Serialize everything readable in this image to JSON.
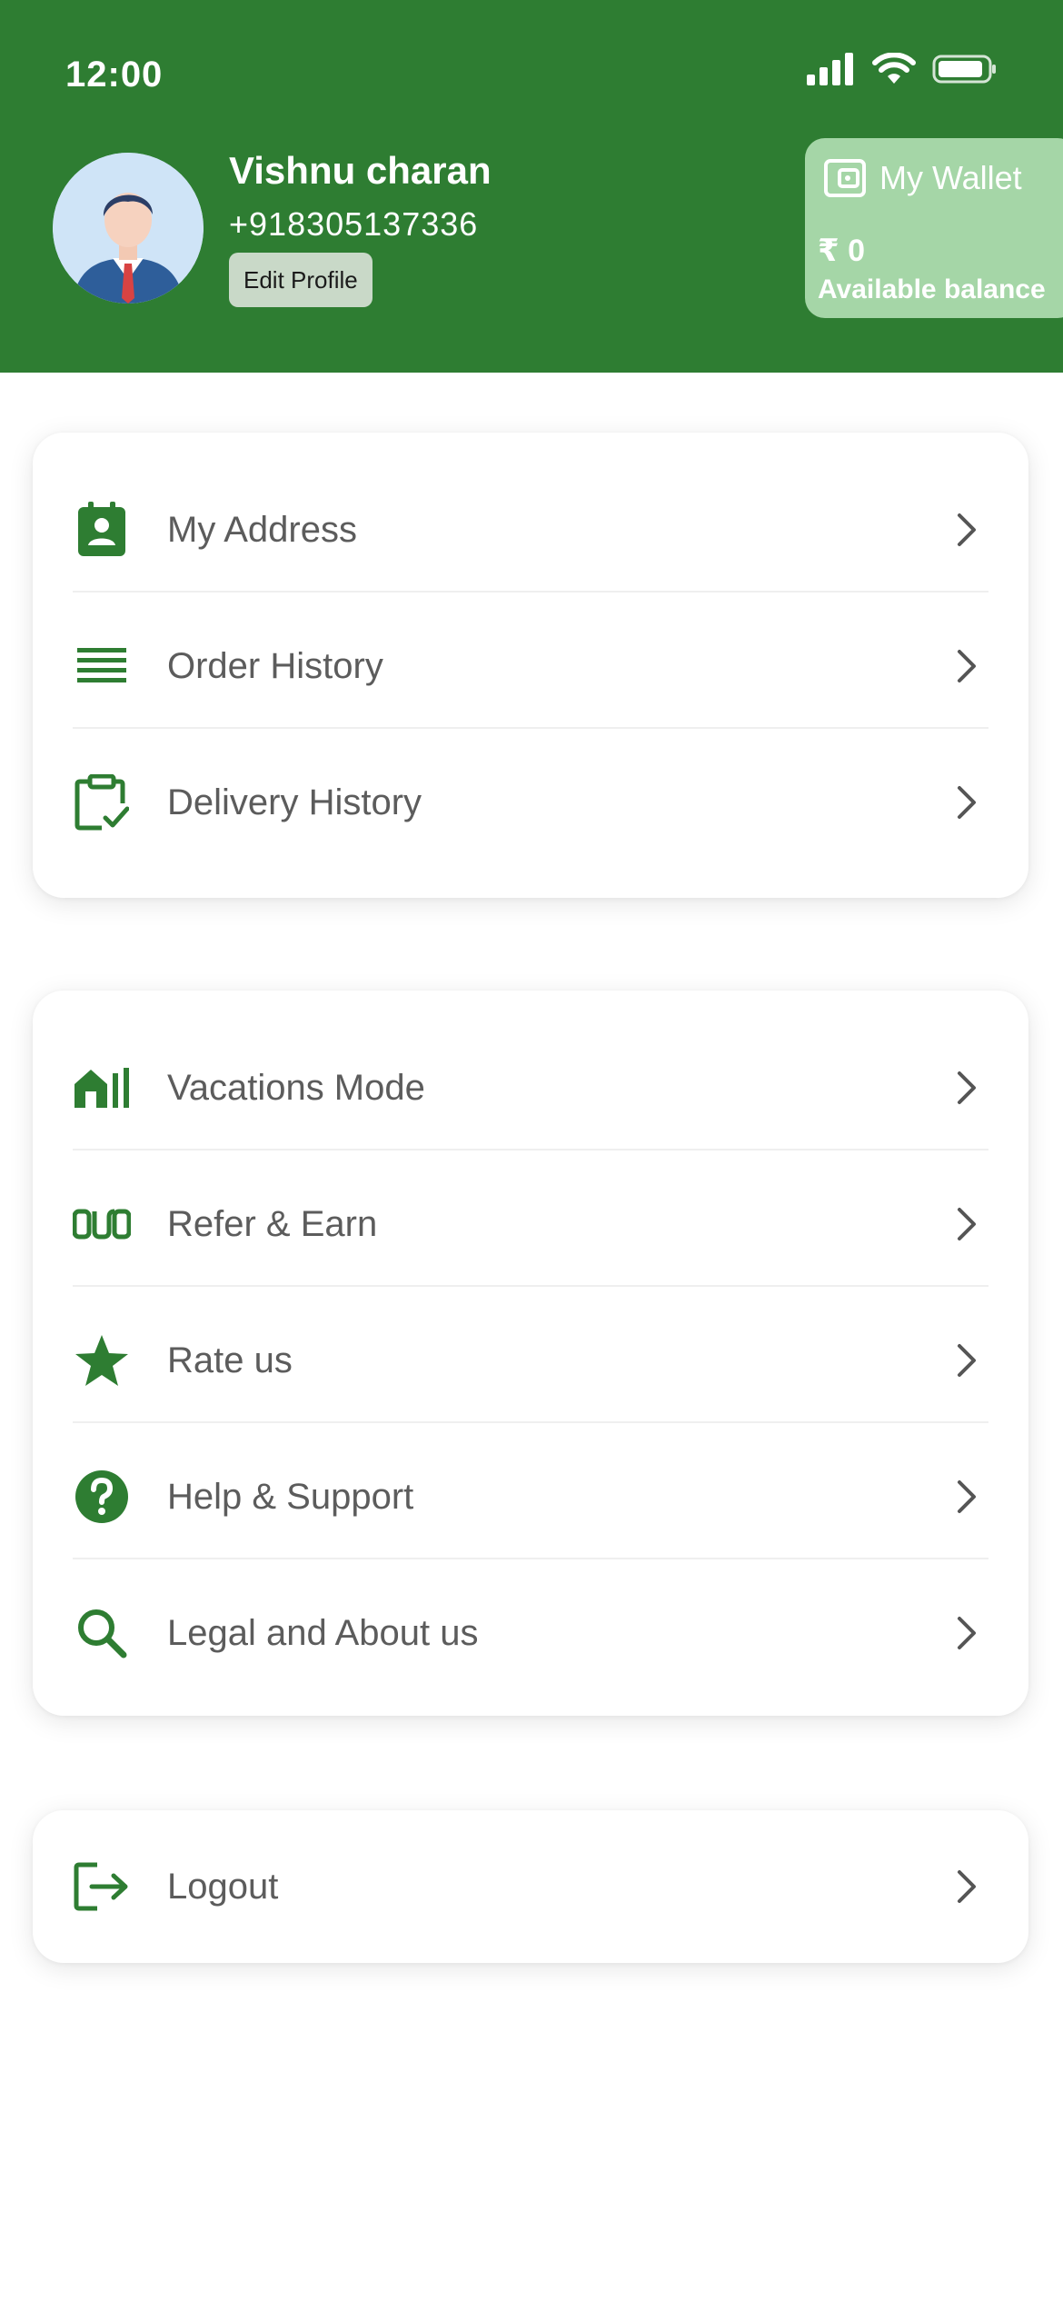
{
  "status_bar": {
    "time": "12:00"
  },
  "profile": {
    "name": "Vishnu charan",
    "phone": "+918305137336",
    "edit_label": "Edit Profile"
  },
  "wallet": {
    "title": "My Wallet",
    "amount": "₹ 0",
    "caption": "Available balance"
  },
  "menu_groups": [
    {
      "items": [
        {
          "label": "My Address",
          "icon": "address-book-icon"
        },
        {
          "label": "Order History",
          "icon": "list-icon"
        },
        {
          "label": "Delivery History",
          "icon": "clipboard-check-icon"
        }
      ]
    },
    {
      "items": [
        {
          "label": "Vacations Mode",
          "icon": "house-icon"
        },
        {
          "label": "Refer & Earn",
          "icon": "refer-icon"
        },
        {
          "label": "Rate us",
          "icon": "star-icon"
        },
        {
          "label": "Help & Support",
          "icon": "help-icon"
        },
        {
          "label": "Legal and About us",
          "icon": "search-icon"
        }
      ]
    },
    {
      "items": [
        {
          "label": "Logout",
          "icon": "logout-icon"
        }
      ]
    }
  ],
  "colors": {
    "primary": "#2e7d32",
    "wallet_bg": "#a5d6a7",
    "label_text": "#5c5c5c"
  }
}
